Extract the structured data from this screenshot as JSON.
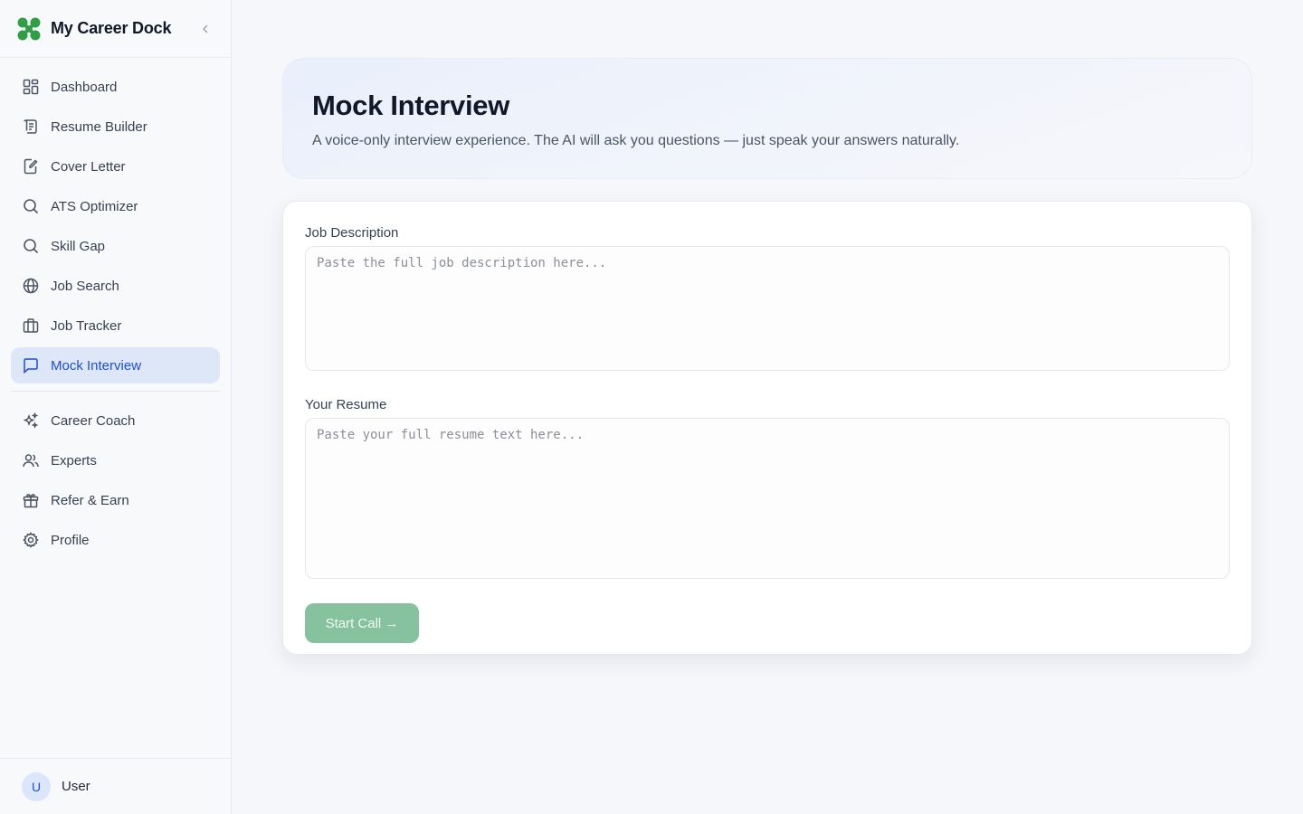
{
  "brand": {
    "name": "My Career Dock",
    "logo_icon": "clover-logo-icon",
    "collapse_icon": "chevron-left-icon"
  },
  "colors": {
    "accent": "#1d4ed8",
    "active_bg": "#dde7f7",
    "button_green": "#86c29e",
    "logo_green": "#2f9e44"
  },
  "sidebar": {
    "items": [
      {
        "label": "Dashboard",
        "icon": "dashboard-grid-icon"
      },
      {
        "label": "Resume Builder",
        "icon": "scroll-document-icon"
      },
      {
        "label": "Cover Letter",
        "icon": "edit-document-icon"
      },
      {
        "label": "ATS Optimizer",
        "icon": "search-icon"
      },
      {
        "label": "Skill Gap",
        "icon": "search-icon"
      },
      {
        "label": "Job Search",
        "icon": "globe-icon"
      },
      {
        "label": "Job Tracker",
        "icon": "briefcase-icon"
      },
      {
        "label": "Mock Interview",
        "icon": "message-square-icon",
        "active": true
      }
    ],
    "secondary_items": [
      {
        "label": "Career Coach",
        "icon": "sparkles-icon"
      },
      {
        "label": "Experts",
        "icon": "users-icon"
      },
      {
        "label": "Refer & Earn",
        "icon": "gift-icon"
      },
      {
        "label": "Profile",
        "icon": "settings-gear-icon"
      }
    ]
  },
  "user": {
    "initial": "U",
    "name": "User"
  },
  "hero": {
    "title": "Mock Interview",
    "subtitle": "A voice-only interview experience. The AI will ask you questions — just speak your answers naturally."
  },
  "form": {
    "job_description": {
      "label": "Job Description",
      "placeholder": "Paste the full job description here...",
      "value": ""
    },
    "resume": {
      "label": "Your Resume",
      "placeholder": "Paste your full resume text here...",
      "value": ""
    },
    "start_button": "Start Call →"
  }
}
